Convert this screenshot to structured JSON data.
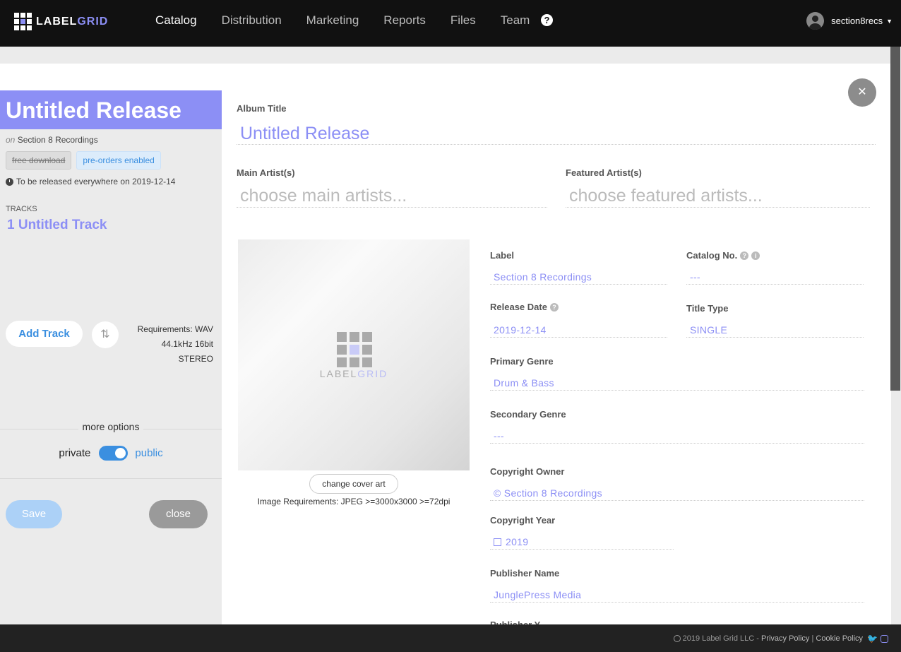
{
  "nav": {
    "logo_label": "LABEL",
    "logo_label_accent": "GRID",
    "items": [
      "Catalog",
      "Distribution",
      "Marketing",
      "Reports",
      "Files",
      "Team"
    ],
    "help": "?",
    "username": "section8recs",
    "caret": "▼"
  },
  "sidebar": {
    "title": "Untitled Release",
    "on_prefix": "on",
    "on_label": "Section 8 Recordings",
    "badge_free": "free download",
    "badge_preorders": "pre-orders enabled",
    "release_note": "To be released everywhere on 2019-12-14",
    "tracks_label": "TRACKS",
    "track_item": "1 Untitled Track",
    "add_track": "Add Track",
    "sort_icon": "⇅",
    "requirements": [
      "Requirements: WAV",
      "44.1kHz 16bit",
      "STEREO"
    ],
    "more_options": "more options",
    "private_label": "private",
    "public_label": "public",
    "save": "Save",
    "close": "close"
  },
  "form": {
    "close_icon": "✕",
    "album_title_label": "Album Title",
    "album_title_value": "Untitled Release",
    "main_artist_label": "Main Artist(s)",
    "main_artist_placeholder": "choose main artists...",
    "featured_artist_label": "Featured Artist(s)",
    "featured_artist_placeholder": "choose featured artists...",
    "cover_text": "LABEL",
    "cover_text_accent": "GRID",
    "change_cover": "change cover art",
    "image_requirements": "Image Requirements: JPEG >=3000x3000 >=72dpi",
    "label_label": "Label",
    "label_value": "Section 8 Recordings",
    "catalog_label": "Catalog No.",
    "catalog_value": "---",
    "release_date_label": "Release Date",
    "release_date_value": "2019-12-14",
    "title_type_label": "Title Type",
    "title_type_value": "SINGLE",
    "primary_genre_label": "Primary Genre",
    "primary_genre_value": "Drum & Bass",
    "secondary_genre_label": "Secondary Genre",
    "secondary_genre_value": "---",
    "copyright_owner_label": "Copyright Owner",
    "copyright_owner_value": "© Section 8 Recordings",
    "copyright_year_label": "Copyright Year",
    "copyright_year_value": "2019",
    "publisher_name_label": "Publisher Name",
    "publisher_name_value": "JunglePress Media",
    "publisher_year_label": "Publisher Y..."
  },
  "footer": {
    "copyright": "2019 Label Grid LLC -",
    "privacy": "Privacy Policy",
    "separator": "|",
    "cookie": "Cookie Policy"
  },
  "colors": {
    "accent": "#8c8ff5",
    "link": "#3b8fe0",
    "nav_bg": "#111111"
  }
}
